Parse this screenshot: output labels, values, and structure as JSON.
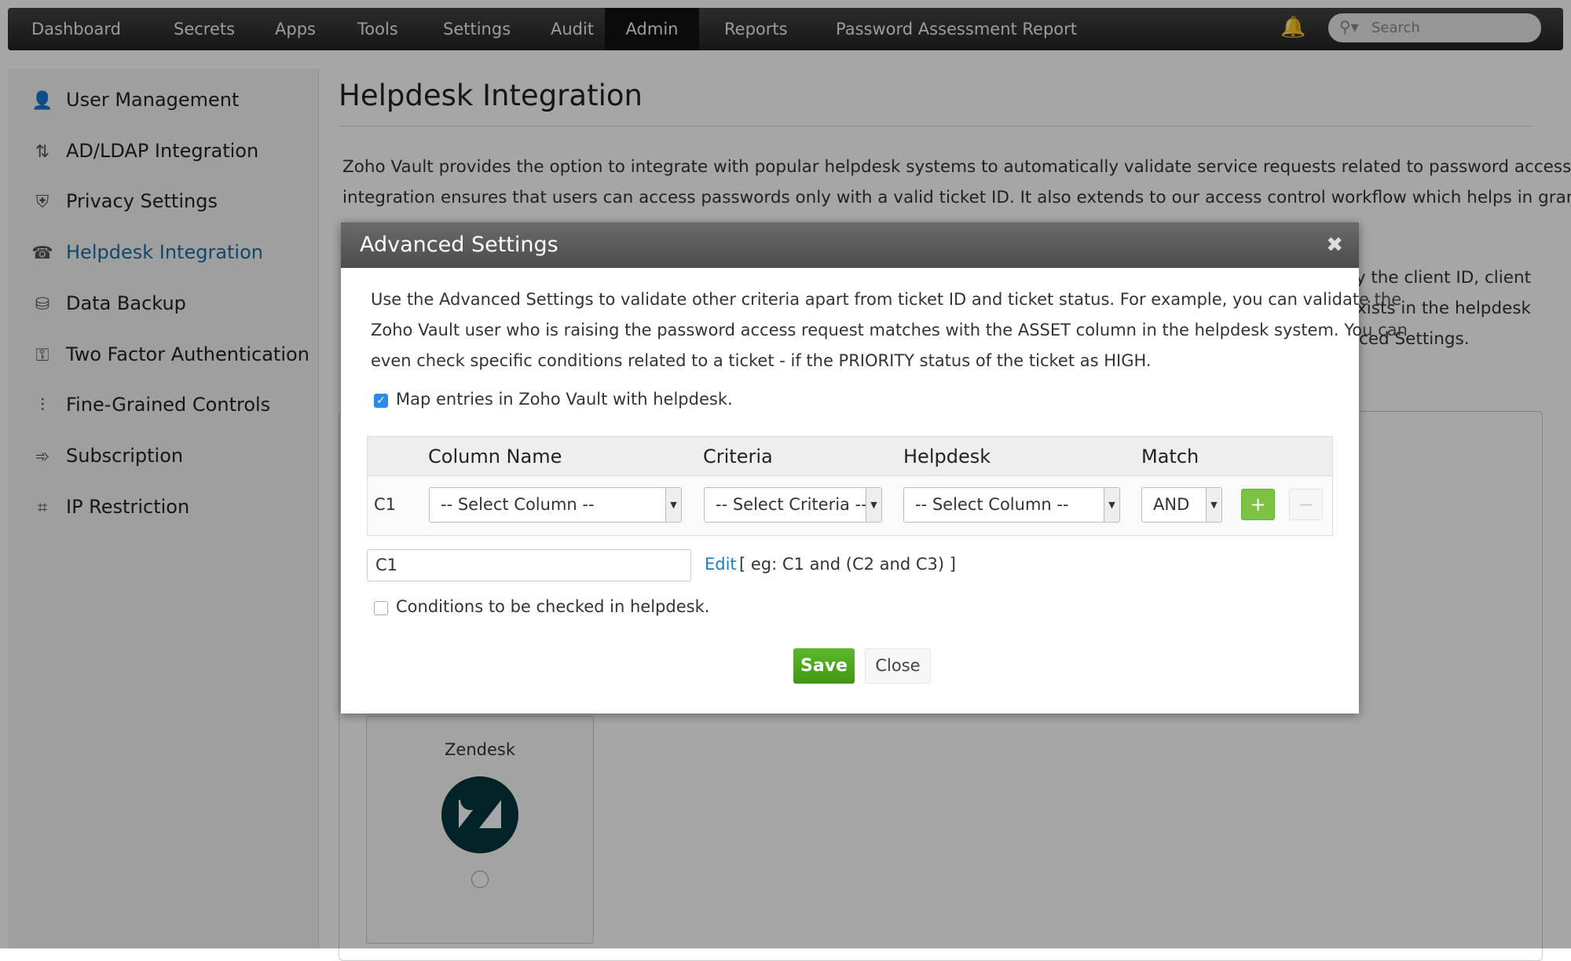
{
  "nav": {
    "items": [
      "Dashboard",
      "Secrets",
      "Apps",
      "Tools",
      "Settings",
      "Audit",
      "Admin",
      "Reports",
      "Password Assessment Report"
    ],
    "active": "Admin",
    "search_placeholder": "Search"
  },
  "sidebar": {
    "items": [
      {
        "label": "User Management",
        "icon": "user-icon"
      },
      {
        "label": "AD/LDAP Integration",
        "icon": "ldap-icon"
      },
      {
        "label": "Privacy Settings",
        "icon": "shield-icon"
      },
      {
        "label": "Helpdesk Integration",
        "icon": "helpdesk-icon",
        "active": true
      },
      {
        "label": "Data Backup",
        "icon": "backup-icon"
      },
      {
        "label": "Two Factor Authentication",
        "icon": "two-factor-icon"
      },
      {
        "label": "Fine-Grained Controls",
        "icon": "sliders-icon"
      },
      {
        "label": "Subscription",
        "icon": "subscription-icon"
      },
      {
        "label": "IP Restriction",
        "icon": "ip-icon"
      }
    ]
  },
  "main": {
    "title": "Helpdesk Integration",
    "para_line1": "Zoho Vault provides the option to integrate with popular helpdesk systems to automatically validate service requests related to password access. The",
    "para_line2": "integration ensures that users can access passwords only with a valid ticket ID. It also extends to our access control workflow which helps in granting",
    "para_frag3": "ify the client ID, client",
    "para_frag4": "exists in the helpdesk",
    "para_frag5": "ced Settings.",
    "card": {
      "label": "Zendesk",
      "color": "#03363d"
    }
  },
  "modal": {
    "title": "Advanced Settings",
    "desc_line1": "Use the Advanced Settings to validate other criteria apart from ticket ID and ticket status. For example, you can validate the",
    "desc_line2": "Zoho Vault user who is raising the password access request matches with the ASSET column in the helpdesk system. You can",
    "desc_line3": "even check specific conditions related to a ticket - if the PRIORITY status of the ticket as HIGH.",
    "map_label": "Map entries in Zoho Vault with helpdesk.",
    "map_checked": true,
    "table": {
      "headers": [
        "Column Name",
        "Criteria",
        "Helpdesk",
        "Match"
      ],
      "row": {
        "id": "C1",
        "column": "-- Select Column --",
        "criteria": "-- Select Criteria --",
        "helpdesk": "-- Select Column --",
        "match": "AND"
      }
    },
    "expression": "C1",
    "edit_label": "Edit",
    "edit_hint": "[ eg: C1 and (C2 and C3) ]",
    "conditions_label": "Conditions to be checked in helpdesk.",
    "conditions_checked": false,
    "save_label": "Save",
    "close_label": "Close",
    "accent": "#4aa21e",
    "link_color": "#1a7fbf"
  }
}
